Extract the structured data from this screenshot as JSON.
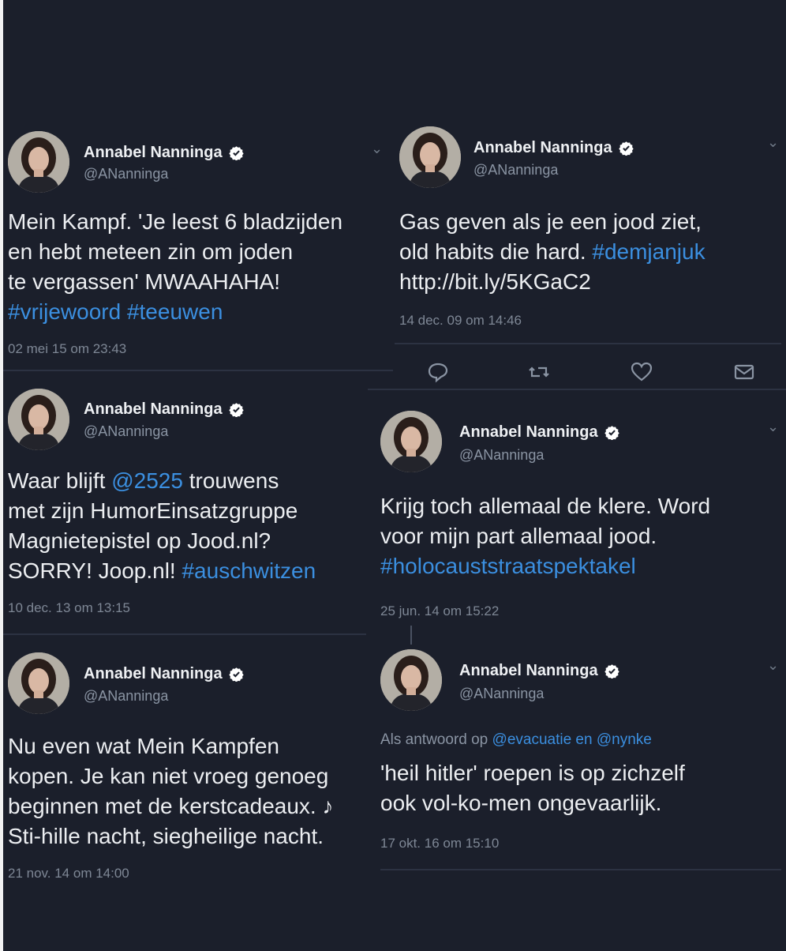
{
  "author": {
    "name": "Annabel Nanninga",
    "handle": "@ANanninga"
  },
  "tweets": [
    {
      "lines": [
        "Mein Kampf. 'Je leest 6 bladzijden",
        "en hebt meteen zin om joden",
        "te vergassen' MWAAHAHA!"
      ],
      "hashtags": "#vrijewoord #teeuwen",
      "timestamp": "02 mei 15 om 23:43"
    },
    {
      "line1": "Gas geven als je een jood ziet,",
      "line2_text": "old habits die hard. ",
      "line2_tag": "#demjanjuk",
      "line3": "http://bit.ly/5KGaC2",
      "timestamp": "14 dec. 09 om 14:46"
    },
    {
      "line1_a": "Waar blijft ",
      "line1_mention": "@2525",
      "line1_b": " trouwens",
      "line2": "met zijn HumorEinsatzgruppe",
      "line3": "Magnietepistel op Jood.nl?",
      "line4_text": "SORRY! Joop.nl! ",
      "line4_tag": "#auschwitzen",
      "timestamp": "10 dec. 13 om 13:15"
    },
    {
      "line1": "Krijg toch allemaal de klere. Word",
      "line2": "voor mijn part allemaal jood.",
      "line3_tag": "#holocauststraatspektakel",
      "timestamp": "25 jun. 14 om 15:22"
    },
    {
      "lines": [
        "Nu even wat Mein Kampfen",
        "kopen. Je kan niet vroeg genoeg",
        "beginnen met de kerstcadeaux. ♪",
        "Sti-hille nacht, siegheilige nacht."
      ],
      "timestamp": "21 nov. 14 om 14:00"
    },
    {
      "reply_prefix": "Als antwoord op ",
      "reply_mentions": "@evacuatie en @nynke",
      "lines": [
        "'heil hitler' roepen is op zichzelf",
        "ook vol-ko-men ongevaarlijk."
      ],
      "timestamp": "17 okt. 16 om 15:10"
    }
  ],
  "actions": [
    "reply-icon",
    "retweet-icon",
    "like-icon",
    "message-icon"
  ],
  "colors": {
    "background": "#1b1f2b",
    "link": "#3b8fe0",
    "verified": "#ffffff"
  }
}
